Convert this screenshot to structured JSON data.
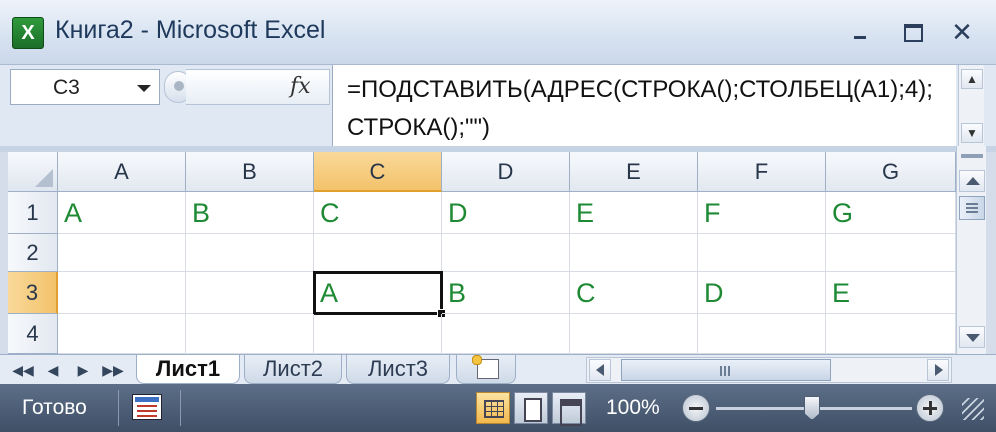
{
  "window": {
    "title": "Книга2 - Microsoft Excel",
    "app_icon_glyph": "X"
  },
  "formula_bar": {
    "name_box": "C3",
    "fx_label": "fx",
    "formula": "=ПОДСТАВИТЬ(АДРЕС(СТРОКА();СТОЛБЕЦ(А1);4);СТРОКА();\"\")",
    "scroll_up_glyph": "▲",
    "scroll_down_glyph": "▼"
  },
  "grid": {
    "columns": [
      "A",
      "B",
      "C",
      "D",
      "E",
      "F",
      "G"
    ],
    "rows": [
      "1",
      "2",
      "3",
      "4"
    ],
    "active_column": "C",
    "active_row": "3",
    "active_cell": "C3",
    "cells": [
      [
        "A",
        "B",
        "C",
        "D",
        "E",
        "F",
        "G"
      ],
      [
        "",
        "",
        "",
        "",
        "",
        "",
        ""
      ],
      [
        "",
        "",
        "A",
        "B",
        "C",
        "D",
        "E"
      ],
      [
        "",
        "",
        "",
        "",
        "",
        "",
        ""
      ]
    ],
    "cell_text_color": "#1e8a34"
  },
  "sheet_tabs": {
    "nav_first": "◀◀",
    "nav_prev": "◀",
    "nav_next": "▶",
    "nav_last": "▶▶",
    "tabs": [
      "Лист1",
      "Лист2",
      "Лист3"
    ],
    "active_tab": "Лист1"
  },
  "status_bar": {
    "status": "Готово",
    "zoom": "100%",
    "zoom_fraction": 0.5,
    "active_view": "normal"
  },
  "colors": {
    "accent_header": "#f3c26a",
    "status_bar": "#4b5c74",
    "title_text": "#1e395b"
  }
}
